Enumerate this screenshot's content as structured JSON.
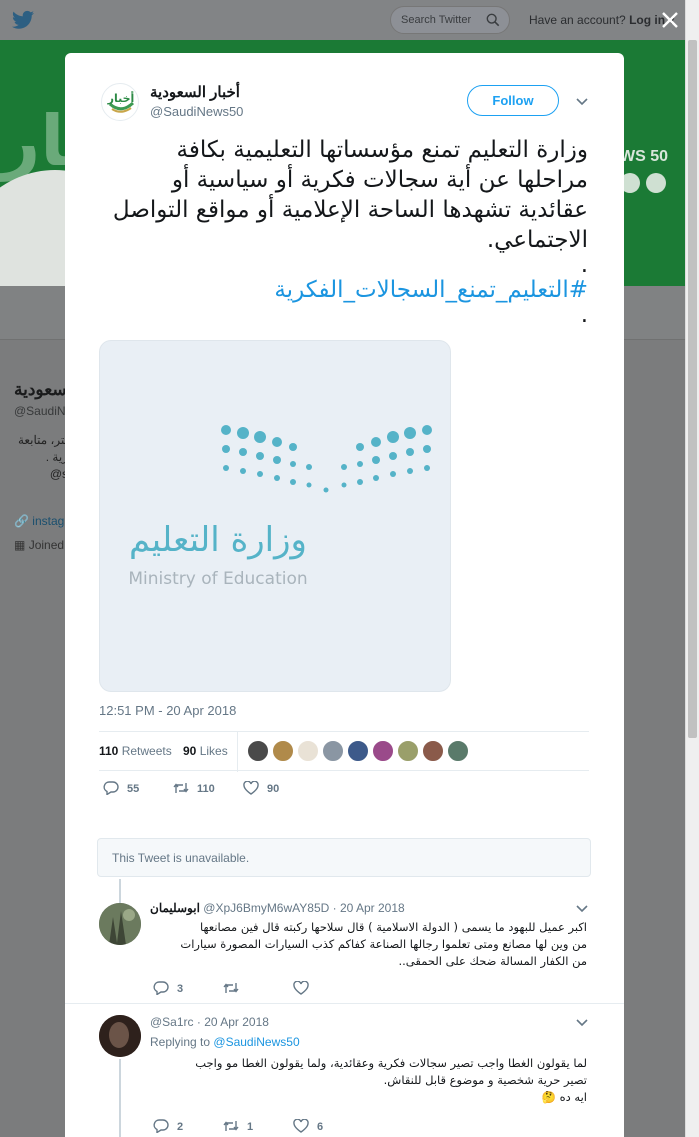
{
  "topbar": {
    "search_placeholder": "Search Twitter",
    "account_prompt": "Have an account?",
    "login_label": "Log in"
  },
  "background_profile": {
    "name_fragment": "سعودية",
    "handle_fragment": "@SaudiN",
    "bio_line1": "يتر، متابعة",
    "bio_line2": "رية .",
    "bio_line3": "s@",
    "link_fragment": "instag",
    "joined_fragment": "Joined",
    "banner_text": "WS 50"
  },
  "tweet": {
    "author_name": "أخبار السعودية",
    "author_handle": "@SaudiNews50",
    "follow_label": "Follow",
    "text": "وزارة التعليم تمنع مؤسساتها التعليمية بكافة مراحلها عن أية سجالات فكرية أو سياسية أو عقائدية تشهدها الساحة الإعلامية أو مواقع التواصل الاجتماعي.",
    "dot1": ".",
    "hashtag": "#التعليم_تمنع_السجالات_الفكرية",
    "dot2": ".",
    "media": {
      "logo_arabic": "وزارة التعليم",
      "logo_english": "Ministry of Education"
    },
    "timestamp": "12:51 PM - 20 Apr 2018",
    "retweets_count": "110",
    "retweets_label": "Retweets",
    "likes_count": "90",
    "likes_label": "Likes",
    "actions": {
      "replies": "55",
      "retweets": "110",
      "likes": "90"
    }
  },
  "unavailable_notice": "This Tweet is unavailable.",
  "replies": [
    {
      "name": "ابوسليمان",
      "handle": "@XpJ6BmyM6wAY85D",
      "date": "· 20 Apr 2018",
      "line1": "اكبر عميل للبهود ما يسمى ( الدولة الاسلامية )  قال  سلاحها ركبته قال فين مصانعها",
      "line2": "من وين  لها مصانع ومتى تعلموا رجالها الصناعة  كفاكم كذب السيارات المصورة سيارات",
      "line3": "من الكفار المسالة ضحك على الحمقى..",
      "reply_count": "3",
      "retweet_count": "",
      "like_count": ""
    },
    {
      "name": "",
      "handle": "@Sa1rc",
      "date": "· 20 Apr 2018",
      "replying_prefix": "Replying to",
      "replying_handle": "@SaudiNews50",
      "line1": "لما يقولون الغطا واجب تصير سجالات فكرية وعقائدية، ولما يقولون الغطا مو واجب",
      "line2": "تصير حرية شخصية و موضوع قابل للنقاش.",
      "line3": "ايه ده 🤔",
      "reply_count": "2",
      "retweet_count": "1",
      "like_count": "6"
    }
  ],
  "colors": {
    "accent": "#1da1f2",
    "link": "#1b95e0",
    "muted": "#657786",
    "banner": "#1b7a35"
  },
  "icons": [
    "twitter-bird-icon",
    "search-icon",
    "close-icon",
    "chevron-down-icon",
    "reply-icon",
    "retweet-icon",
    "like-icon",
    "link-icon",
    "calendar-icon"
  ]
}
